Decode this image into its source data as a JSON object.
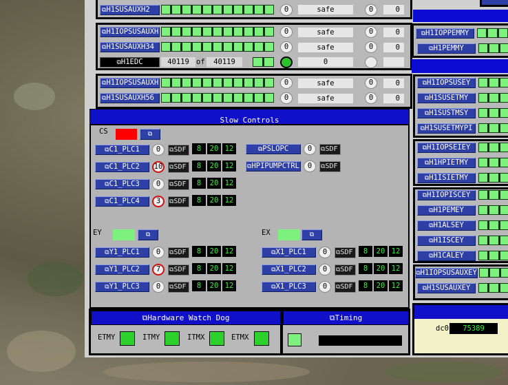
{
  "top_panel": {
    "row1": {
      "button": "H1SUSAUXH2",
      "count": "0",
      "status": "safe",
      "a": "0",
      "b": "0"
    },
    "group2": [
      {
        "button": "H1IOPSUSAUXH34",
        "count": "0",
        "status": "safe",
        "a": "0",
        "b": "0"
      },
      {
        "button": "H1SUSAUXH34",
        "count": "0",
        "status": "safe",
        "a": "0",
        "b": "0"
      }
    ],
    "edc": {
      "button": "H1EDC",
      "value": "40119",
      "of_label": "of",
      "total": "40119",
      "status": "0"
    },
    "group3": [
      {
        "button": "H1IOPSUSAUXH56",
        "count": "0",
        "status": "safe",
        "a": "0",
        "b": "0"
      },
      {
        "button": "H1SUSAUXH56",
        "count": "0",
        "status": "safe",
        "a": "0",
        "b": "0"
      }
    ]
  },
  "right_buttons": [
    {
      "label": "H1IOPPEMMY"
    },
    {
      "label": "H1PEMMY"
    },
    {
      "label": "H1IOPSUSEY"
    },
    {
      "label": "H1SUSETMY"
    },
    {
      "label": "H1SUSTMSY"
    },
    {
      "label": "H1SUSETMYPI"
    },
    {
      "label": "H1IOPSEIEY"
    },
    {
      "label": "H1HPIETMY"
    },
    {
      "label": "H1ISIETMY"
    },
    {
      "label": "H1IOPISCEY"
    },
    {
      "label": "H1PEMEY"
    },
    {
      "label": "H1ALSEY"
    },
    {
      "label": "H1ISCEY"
    },
    {
      "label": "H1CALEY"
    },
    {
      "label": "H1IOPSUSAUXEY"
    },
    {
      "label": "H1SUSAUXEY"
    }
  ],
  "dc0": {
    "label": "dc0",
    "value": "75389"
  },
  "slow_controls": {
    "title": "Slow Controls",
    "cs_label": "CS",
    "cs_rows": [
      {
        "button": "C1_PLC1",
        "count": "0",
        "sdf": "SDF",
        "n1": "8",
        "n2": "20",
        "n3": "12",
        "alarm": false
      },
      {
        "button": "C1_PLC2",
        "count": "10",
        "sdf": "SDF",
        "n1": "8",
        "n2": "20",
        "n3": "12",
        "alarm": true
      },
      {
        "button": "C1_PLC3",
        "count": "0",
        "sdf": "SDF",
        "n1": "8",
        "n2": "20",
        "n3": "12",
        "alarm": false
      },
      {
        "button": "C1_PLC4",
        "count": "3",
        "sdf": "SDF",
        "n1": "8",
        "n2": "20",
        "n3": "12",
        "alarm": true
      }
    ],
    "cs_right": [
      {
        "button": "PSLOPC",
        "count": "0",
        "sdf": "SDF"
      },
      {
        "button": "HPIPUMPCTRL",
        "count": "0",
        "sdf": "SDF"
      }
    ],
    "ey_label": "EY",
    "ey_rows": [
      {
        "button": "Y1_PLC1",
        "count": "0",
        "sdf": "SDF",
        "n1": "8",
        "n2": "20",
        "n3": "12",
        "alarm": false
      },
      {
        "button": "Y1_PLC2",
        "count": "7",
        "sdf": "SDF",
        "n1": "8",
        "n2": "20",
        "n3": "12",
        "alarm": true
      },
      {
        "button": "Y1_PLC3",
        "count": "0",
        "sdf": "SDF",
        "n1": "8",
        "n2": "20",
        "n3": "12",
        "alarm": false
      }
    ],
    "ex_label": "EX",
    "ex_rows": [
      {
        "button": "X1_PLC1",
        "count": "0",
        "sdf": "SDF",
        "n1": "8",
        "n2": "20",
        "n3": "12"
      },
      {
        "button": "X1_PLC2",
        "count": "0",
        "sdf": "SDF",
        "n1": "8",
        "n2": "20",
        "n3": "12"
      },
      {
        "button": "X1_PLC3",
        "count": "0",
        "sdf": "SDF",
        "n1": "8",
        "n2": "20",
        "n3": "12"
      }
    ]
  },
  "watchdog": {
    "title": "Hardware Watch Dog",
    "items": [
      {
        "label": "ETMY"
      },
      {
        "label": "ITMY"
      },
      {
        "label": "ITMX"
      },
      {
        "label": "ETMX"
      }
    ]
  },
  "timing": {
    "title": "Timing"
  },
  "colors": {
    "button": "#2e3fa5",
    "bar_ok": "#7ef07e",
    "header": "#1010c8",
    "alarm": "#d01010",
    "cs_indicator": "#ff0000",
    "ok": "#2cd12c"
  }
}
